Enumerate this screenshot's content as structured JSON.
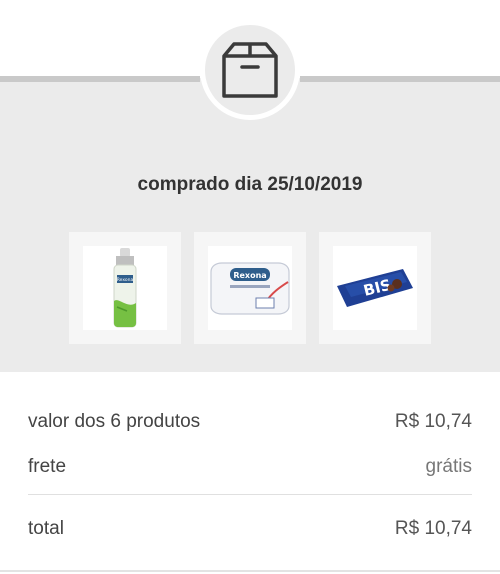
{
  "header": {
    "icon": "box-icon"
  },
  "purchase": {
    "date_label": "comprado dia 25/10/2019"
  },
  "products": [
    {
      "name": "Rexona",
      "icon": "deodorant-image"
    },
    {
      "name": "Rexona",
      "icon": "soap-image"
    },
    {
      "name": "BIS",
      "icon": "chocolate-pack-image"
    }
  ],
  "summary": {
    "products_label": "valor dos 6 produtos",
    "products_value": "R$ 10,74",
    "shipping_label": "frete",
    "shipping_value": "grátis",
    "total_label": "total",
    "total_value": "R$ 10,74"
  },
  "colors": {
    "panel": "#ebebeb",
    "accent_line": "#c9c9c9",
    "text": "#444444"
  }
}
